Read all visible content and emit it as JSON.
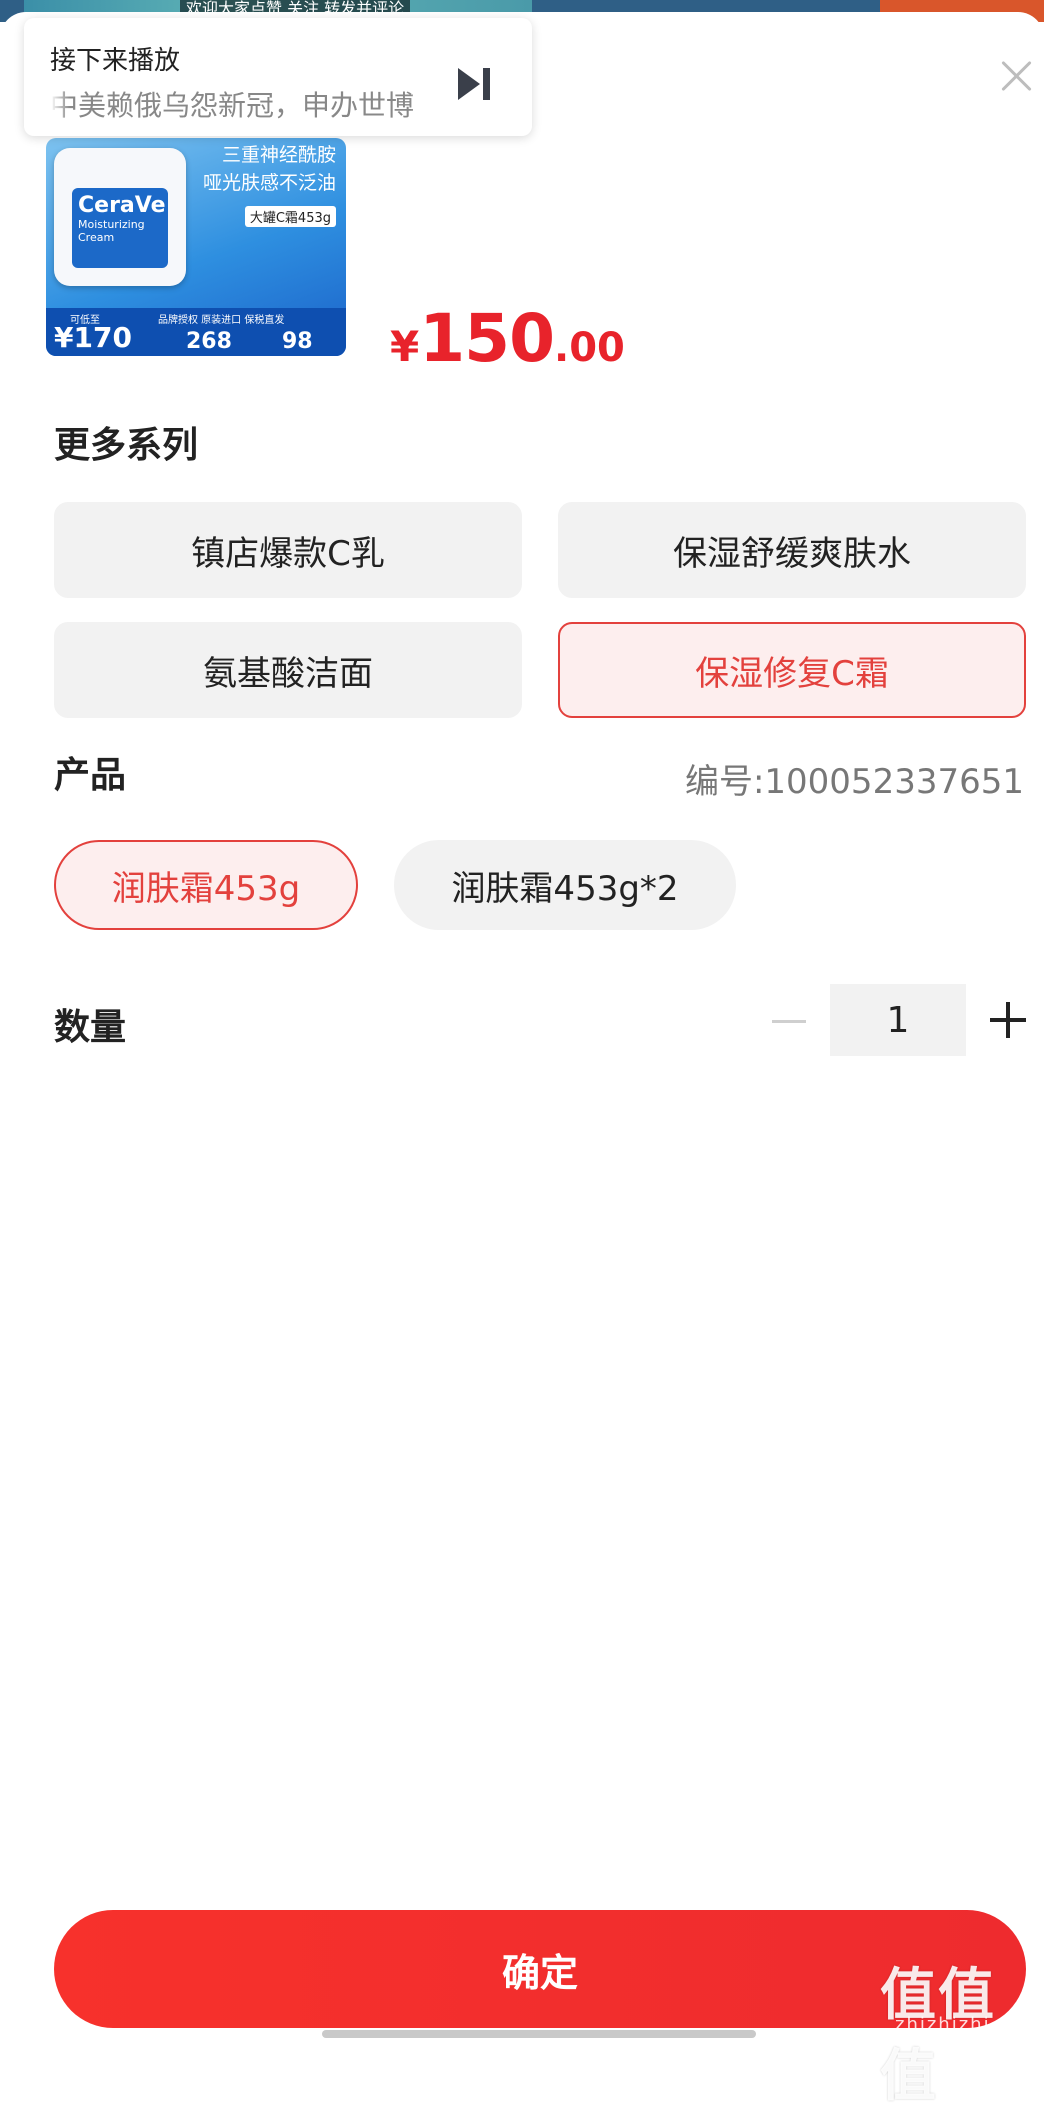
{
  "video": {
    "ticker": "欢迎大家点赞 关注 转发并评论"
  },
  "pip": {
    "title": "接下来播放",
    "next_title": "中美赖俄乌怨新冠，申办世博"
  },
  "product": {
    "image_text": {
      "line1": "三重神经酰胺",
      "line2": "哑光肤感不泛油",
      "tag": "大罐C霜453g",
      "brand": "CeraVe",
      "jar_sub": "Moisturizing Cream",
      "price_low_label": "可低至",
      "price_low": "¥170",
      "badges": "品牌授权 原装进口 保税直发",
      "val1": "268",
      "val2": "98"
    },
    "price": {
      "currency": "¥",
      "integer": "150",
      "decimal": ".00"
    }
  },
  "series": {
    "title": "更多系列",
    "options": [
      {
        "label": "镇店爆款C乳",
        "selected": false
      },
      {
        "label": "保湿舒缓爽肤水",
        "selected": false
      },
      {
        "label": "氨基酸洁面",
        "selected": false
      },
      {
        "label": "保湿修复C霜",
        "selected": true
      }
    ]
  },
  "product_section": {
    "title": "产品",
    "code": "编号:100052337651",
    "options": [
      {
        "label": "润肤霜453g",
        "selected": true
      },
      {
        "label": "润肤霜453g*2",
        "selected": false
      }
    ]
  },
  "quantity": {
    "label": "数量",
    "value": "1"
  },
  "confirm": {
    "label": "确定"
  },
  "watermark": {
    "main": "值值值",
    "sub": "zhizhizhi.com"
  },
  "colors": {
    "accent": "#e8232b",
    "selected_bg": "#fdeeee",
    "selected_border": "#e3413d",
    "option_bg": "#f2f2f2"
  }
}
